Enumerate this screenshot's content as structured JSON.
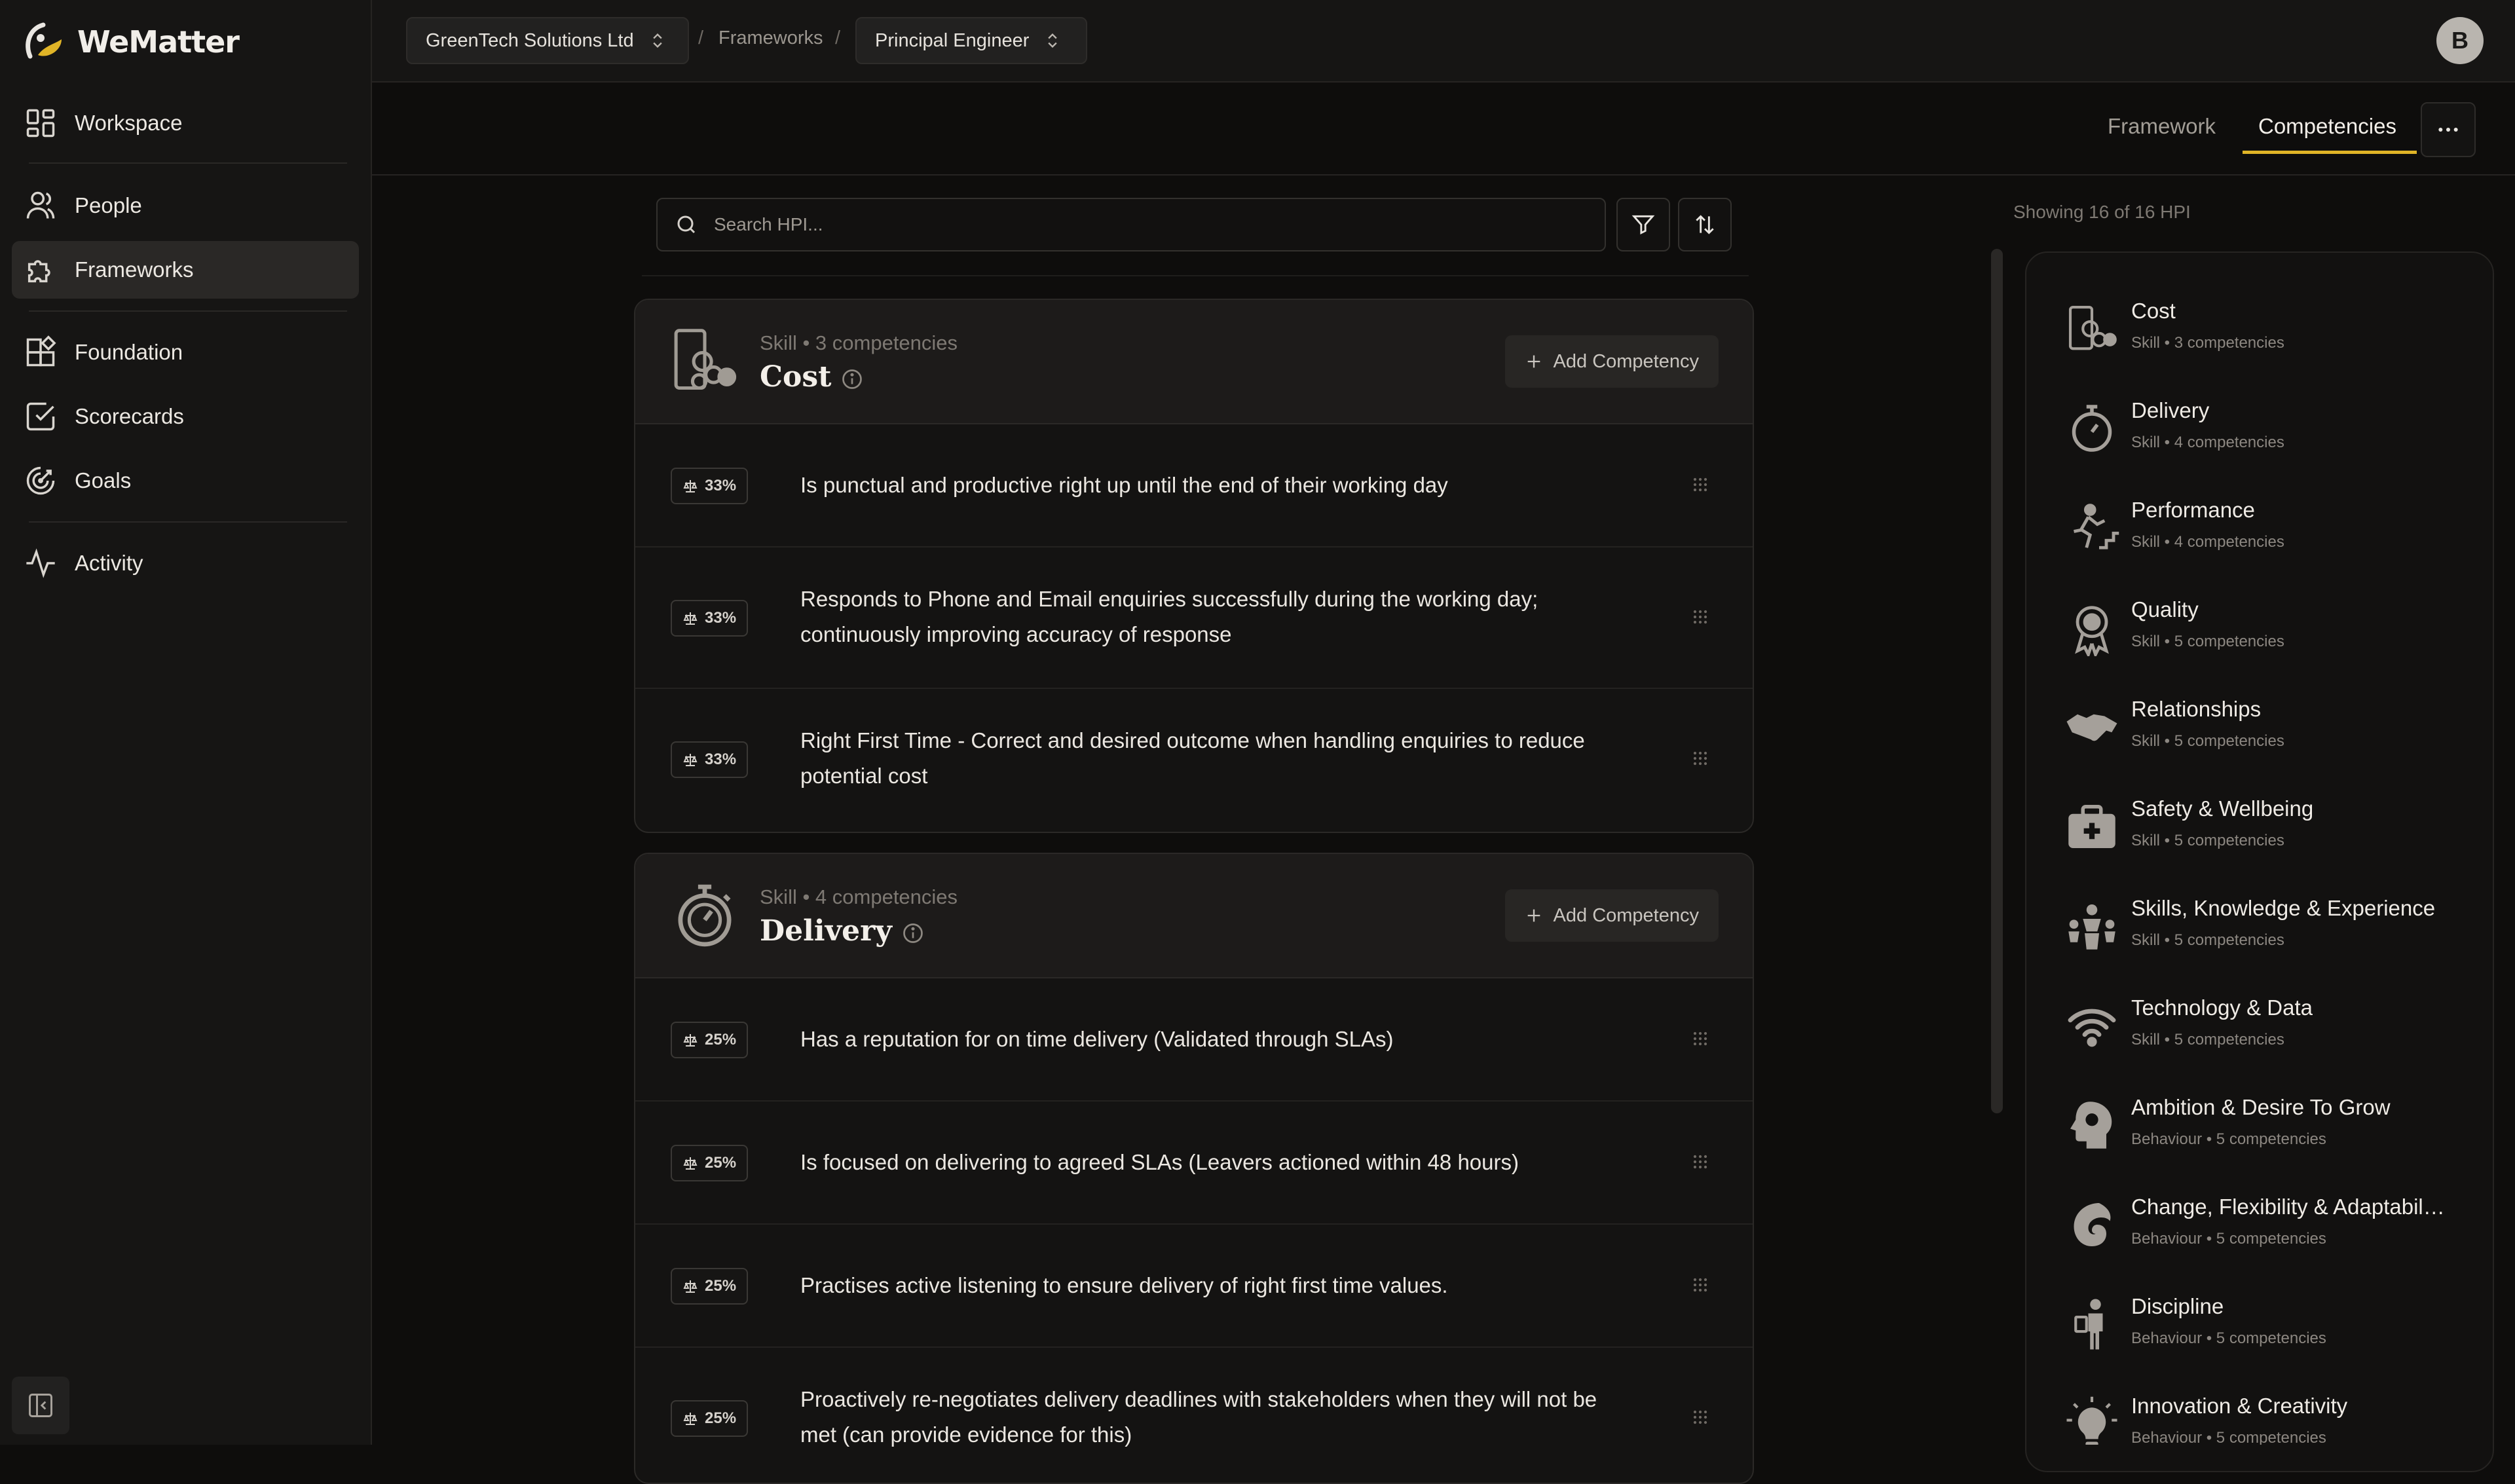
{
  "app": {
    "name": "WeMatter"
  },
  "sidebar": {
    "items": [
      {
        "label": "Workspace",
        "icon": "layout-grid-icon"
      },
      {
        "label": "People",
        "icon": "user-icon"
      },
      {
        "label": "Frameworks",
        "icon": "puzzle-icon",
        "active": true
      },
      {
        "label": "Foundation",
        "icon": "blocks-icon"
      },
      {
        "label": "Scorecards",
        "icon": "check-square-icon"
      },
      {
        "label": "Goals",
        "icon": "target-icon"
      },
      {
        "label": "Activity",
        "icon": "activity-icon"
      }
    ]
  },
  "topbar": {
    "org": "GreenTech Solutions Ltd",
    "separator": "/",
    "frameworks": "Frameworks",
    "role": "Principal Engineer",
    "avatar_initial": "B"
  },
  "tabs": {
    "framework": "Framework",
    "competencies": "Competencies"
  },
  "search": {
    "placeholder": "Search HPI..."
  },
  "right_panel": {
    "showing": "Showing 16 of 16 HPI",
    "items": [
      {
        "title": "Cost",
        "sub": "Skill • 3 competencies"
      },
      {
        "title": "Delivery",
        "sub": "Skill • 4 competencies"
      },
      {
        "title": "Performance",
        "sub": "Skill • 4 competencies"
      },
      {
        "title": "Quality",
        "sub": "Skill • 5 competencies"
      },
      {
        "title": "Relationships",
        "sub": "Skill • 5 competencies"
      },
      {
        "title": "Safety & Wellbeing",
        "sub": "Skill • 5 competencies"
      },
      {
        "title": "Skills, Knowledge & Experience",
        "sub": "Skill • 5 competencies"
      },
      {
        "title": "Technology & Data",
        "sub": "Skill • 5 competencies"
      },
      {
        "title": "Ambition & Desire To Grow",
        "sub": "Behaviour • 5 competencies"
      },
      {
        "title": "Change, Flexibility & Adaptabil…",
        "sub": "Behaviour • 5 competencies"
      },
      {
        "title": "Discipline",
        "sub": "Behaviour • 5 competencies"
      },
      {
        "title": "Innovation & Creativity",
        "sub": "Behaviour • 5 competencies"
      }
    ]
  },
  "cards": [
    {
      "meta": "Skill • 3 competencies",
      "title": "Cost",
      "add_label": "Add Competency",
      "rows": [
        {
          "weight": "33%",
          "text": "Is punctual and productive right up until the end of their working day"
        },
        {
          "weight": "33%",
          "text": "Responds to Phone and Email enquiries successfully during the working day; continuously improving accuracy of response"
        },
        {
          "weight": "33%",
          "text": "Right First Time - Correct and desired outcome when handling enquiries to reduce potential cost"
        }
      ]
    },
    {
      "meta": "Skill • 4 competencies",
      "title": "Delivery",
      "add_label": "Add Competency",
      "rows": [
        {
          "weight": "25%",
          "text": "Has a reputation for on time delivery (Validated through SLAs)"
        },
        {
          "weight": "25%",
          "text": "Is focused on delivering to agreed SLAs (Leavers actioned within 48 hours)"
        },
        {
          "weight": "25%",
          "text": "Practises active listening to ensure delivery of right first time values."
        },
        {
          "weight": "25%",
          "text": "Proactively re-negotiates delivery deadlines with stakeholders when they will not be met (can provide evidence for this)"
        }
      ]
    }
  ],
  "colors": {
    "accent": "#e0b427",
    "background": "#0e0d0c",
    "sidebar": "#161514"
  }
}
